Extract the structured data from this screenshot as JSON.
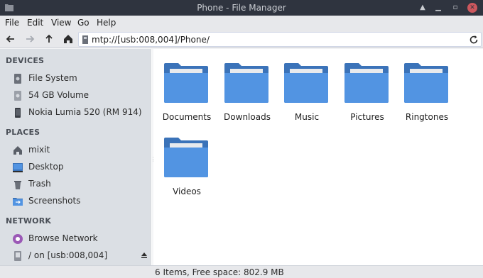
{
  "window": {
    "title": "Phone - File Manager"
  },
  "menu": [
    "File",
    "Edit",
    "View",
    "Go",
    "Help"
  ],
  "toolbar": {
    "path": "mtp://[usb:008,004]/Phone/"
  },
  "sidebar": {
    "devices_header": "DEVICES",
    "devices": [
      {
        "label": "File System",
        "icon": "drive-icon"
      },
      {
        "label": "54 GB Volume",
        "icon": "drive-icon"
      },
      {
        "label": "Nokia Lumia 520 (RM 914)",
        "icon": "phone-icon"
      }
    ],
    "places_header": "PLACES",
    "places": [
      {
        "label": "mixit",
        "icon": "home-icon"
      },
      {
        "label": "Desktop",
        "icon": "desktop-icon"
      },
      {
        "label": "Trash",
        "icon": "trash-icon"
      },
      {
        "label": "Screenshots",
        "icon": "folder-icon"
      }
    ],
    "network_header": "NETWORK",
    "network": [
      {
        "label": "Browse Network",
        "icon": "network-icon"
      },
      {
        "label": "/ on [usb:008,004]",
        "icon": "device-icon"
      }
    ]
  },
  "files": [
    {
      "name": "Documents"
    },
    {
      "name": "Downloads"
    },
    {
      "name": "Music"
    },
    {
      "name": "Pictures"
    },
    {
      "name": "Ringtones"
    },
    {
      "name": "Videos"
    }
  ],
  "status": {
    "text": "6 Items, Free space: 802.9 MB"
  },
  "colors": {
    "folder": "#5294e2",
    "folder_dark": "#3b73b9",
    "titlebar": "#2f343f",
    "sidebar": "#dbdfe4",
    "close": "#cc575d"
  }
}
